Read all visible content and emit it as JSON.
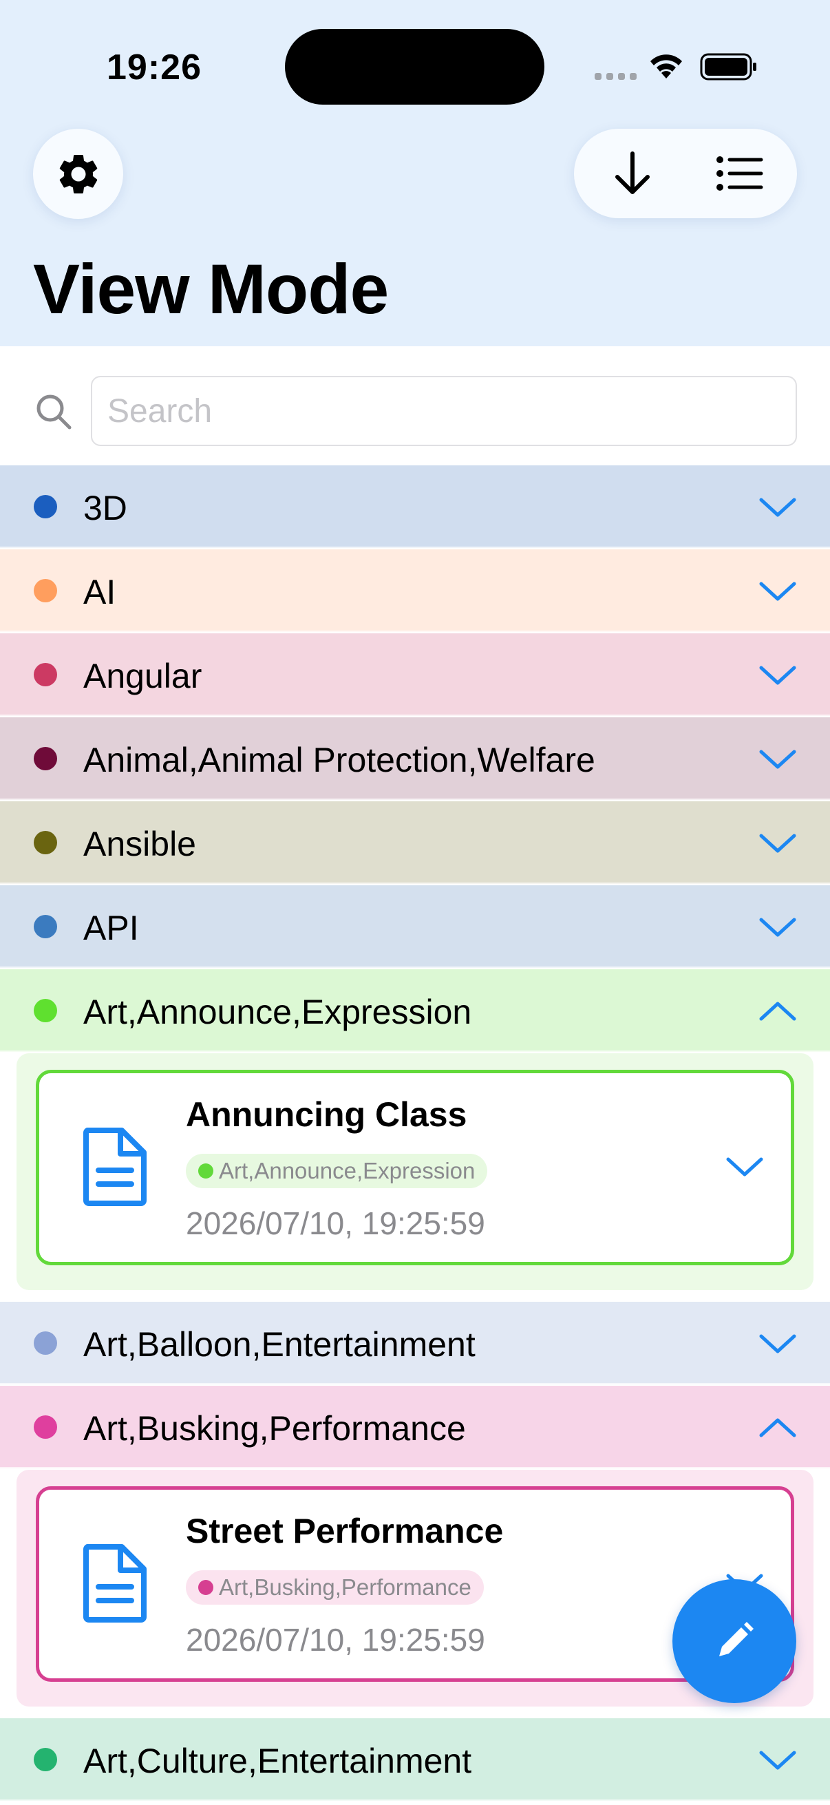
{
  "status_bar": {
    "time": "19:26"
  },
  "header": {
    "title": "View Mode"
  },
  "search": {
    "placeholder": "Search",
    "value": ""
  },
  "groups": [
    {
      "label": "3D",
      "dot_color": "#1b5ebf",
      "bg_color": "#d0ddef",
      "expanded": false
    },
    {
      "label": "AI",
      "dot_color": "#ff9e5e",
      "bg_color": "#ffebe0",
      "expanded": false
    },
    {
      "label": "Angular",
      "dot_color": "#cc3a63",
      "bg_color": "#f4d6e0",
      "expanded": false
    },
    {
      "label": "Animal,Animal Protection,Welfare",
      "dot_color": "#6f0b39",
      "bg_color": "#e1d0d8",
      "expanded": false
    },
    {
      "label": "Ansible",
      "dot_color": "#6a6410",
      "bg_color": "#dfdece",
      "expanded": false
    },
    {
      "label": "API",
      "dot_color": "#3b7bbf",
      "bg_color": "#d4e0ee",
      "expanded": false
    },
    {
      "label": "Art,Announce,Expression",
      "dot_color": "#5fe02f",
      "bg_color": "#dcf8d4",
      "expanded": true
    },
    {
      "label": "Art,Balloon,Entertainment",
      "dot_color": "#8ba2d6",
      "bg_color": "#e1e8f4",
      "expanded": false
    },
    {
      "label": "Art,Busking,Performance",
      "dot_color": "#df3f9e",
      "bg_color": "#f7d5e8",
      "expanded": true
    },
    {
      "label": "Art,Culture,Entertainment",
      "dot_color": "#24b36f",
      "bg_color": "#d2eee1",
      "expanded": false
    }
  ],
  "notes": [
    {
      "title": "Annuncing Class",
      "tag": "Art,Announce,Expression",
      "date": "2026/07/10, 19:25:59",
      "accent": "#62d93a",
      "tag_bg": "#e7f9e0",
      "panel_bg": "#ecfae6"
    },
    {
      "title": "Street Performance",
      "tag": "Art,Busking,Performance",
      "date": "2026/07/10, 19:25:59",
      "accent": "#d63f91",
      "tag_bg": "#fbe3ef",
      "panel_bg": "#fbe6f1"
    }
  ],
  "colors": {
    "accent": "#1c87f2",
    "header_bg": "#e3effc",
    "chevron": "#1c87f2"
  },
  "icons": {
    "settings": "gear-icon",
    "sort": "arrow-down-icon",
    "list": "list-icon",
    "search": "search-icon",
    "note": "document-icon",
    "compose": "pencil-icon"
  }
}
